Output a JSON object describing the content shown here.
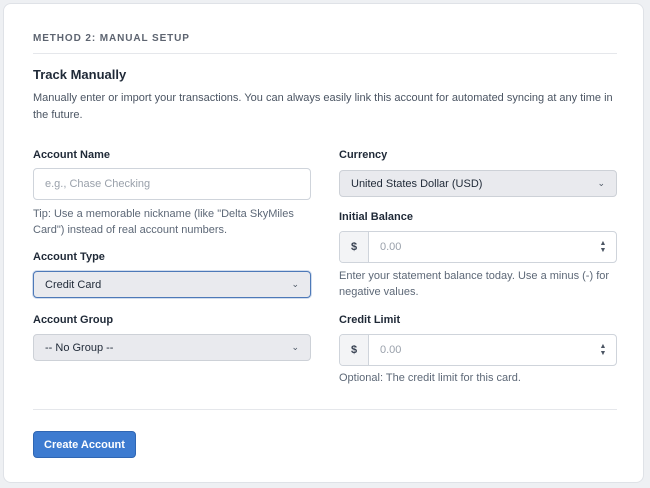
{
  "section": {
    "label": "METHOD 2: MANUAL SETUP"
  },
  "header": {
    "title": "Track Manually",
    "description": "Manually enter or import your transactions. You can always easily link this account for automated syncing at any time in the future."
  },
  "form": {
    "account_name": {
      "label": "Account Name",
      "placeholder": "e.g., Chase Checking",
      "help": "Tip: Use a memorable nickname (like \"Delta SkyMiles Card\") instead of real account numbers."
    },
    "account_type": {
      "label": "Account Type",
      "selected": "Credit Card"
    },
    "account_group": {
      "label": "Account Group",
      "selected": "-- No Group --"
    },
    "currency": {
      "label": "Currency",
      "selected": "United States Dollar (USD)"
    },
    "initial_balance": {
      "label": "Initial Balance",
      "prefix": "$",
      "placeholder": "0.00",
      "help": "Enter your statement balance today. Use a minus (-) for negative values."
    },
    "credit_limit": {
      "label": "Credit Limit",
      "prefix": "$",
      "placeholder": "0.00",
      "help": "Optional: The credit limit for this card."
    }
  },
  "actions": {
    "submit_label": "Create Account"
  },
  "icons": {
    "select_chevron": "chevron-down-icon",
    "spinner": "stepper-icon"
  },
  "colors": {
    "primary": "#3d7bd0",
    "focus_border": "#4d79b8"
  }
}
